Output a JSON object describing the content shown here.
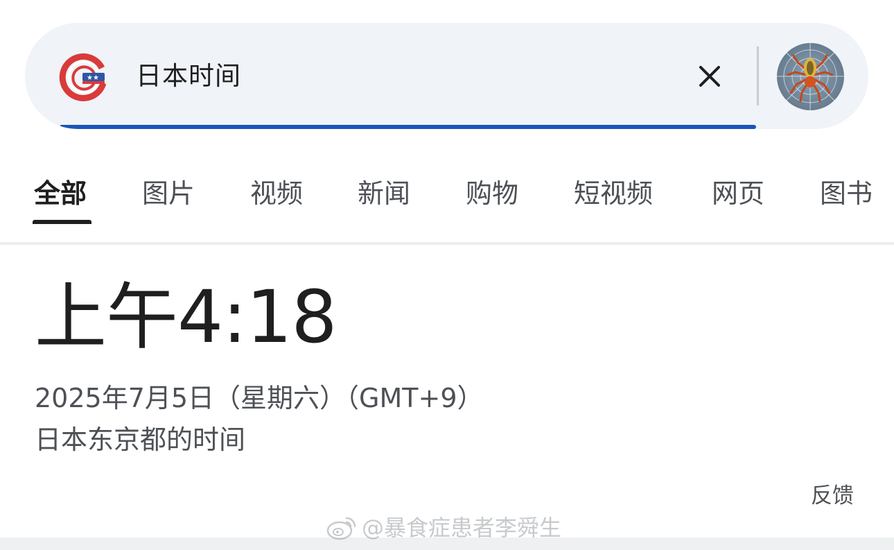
{
  "search": {
    "query": "日本时间",
    "logo_icon": "google-flag-g-icon",
    "clear_icon": "close-icon",
    "avatar_icon": "spider-avatar",
    "accent_color": "#1a55b8",
    "loading_progress": 0.9
  },
  "tabs": [
    {
      "label": "全部",
      "active": true
    },
    {
      "label": "图片",
      "active": false
    },
    {
      "label": "视频",
      "active": false
    },
    {
      "label": "新闻",
      "active": false
    },
    {
      "label": "购物",
      "active": false
    },
    {
      "label": "短视频",
      "active": false
    },
    {
      "label": "网页",
      "active": false
    },
    {
      "label": "图书",
      "active": false
    }
  ],
  "time_card": {
    "time": "上午4:18",
    "date_line": "2025年7月5日（星期六）（GMT+9）",
    "location_line": "日本东京都的时间",
    "feedback": "反馈"
  },
  "watermark": {
    "text": "@暴食症患者李舜生",
    "icon": "weibo-icon"
  }
}
